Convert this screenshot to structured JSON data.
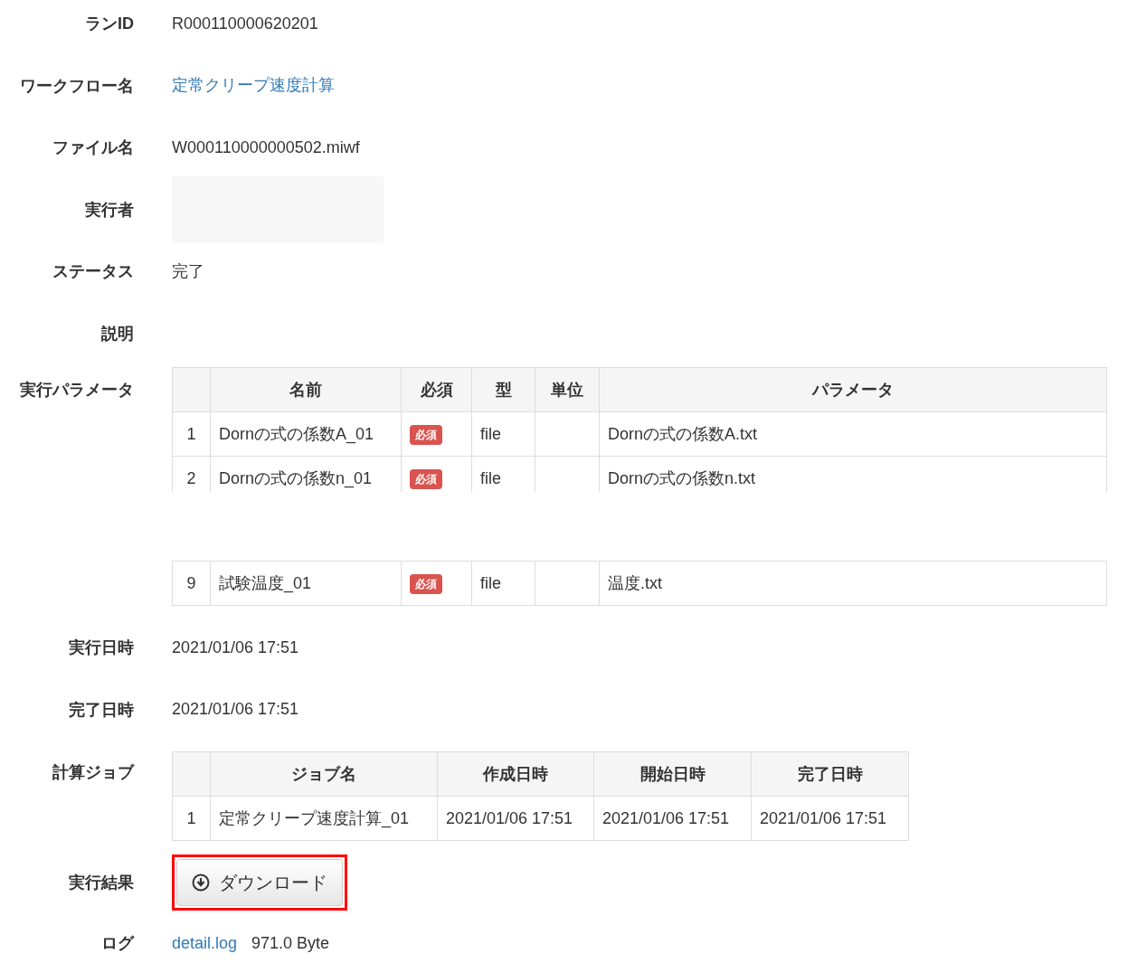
{
  "fields": [
    {
      "kind": "text",
      "label": "ランID",
      "value": "R000110000620201"
    },
    {
      "kind": "link",
      "label": "ワークフロー名",
      "value": "定常クリープ速度計算"
    },
    {
      "kind": "text",
      "label": "ファイル名",
      "value": "W000110000000502.miwf"
    },
    {
      "kind": "redacted",
      "label": "実行者"
    },
    {
      "kind": "text",
      "label": "ステータス",
      "value": "完了"
    },
    {
      "kind": "text",
      "label": "説明"
    },
    {
      "kind": "params",
      "label": "実行パラメータ",
      "columns": [
        "",
        "名前",
        "必須",
        "型",
        "単位",
        "パラメータ"
      ],
      "parts": [
        {
          "cut": true,
          "rows": [
            {
              "cells": [
                "1",
                "Dornの式の係数A_01",
                "必須",
                "file",
                "",
                "Dornの式の係数A.txt"
              ],
              "required": true
            },
            {
              "cells": [
                "2",
                "Dornの式の係数n_01",
                "必須",
                "file",
                "",
                "Dornの式の係数n.txt"
              ],
              "required": true
            }
          ]
        },
        {
          "cut": false,
          "rows": [
            {
              "cells": [
                "9",
                "試験温度_01",
                "必須",
                "file",
                "",
                "温度.txt"
              ],
              "required": true
            }
          ]
        }
      ]
    },
    {
      "kind": "text",
      "label": "実行日時",
      "value": "2021/01/06 17:51"
    },
    {
      "kind": "text",
      "label": "完了日時",
      "value": "2021/01/06 17:51"
    },
    {
      "kind": "jobs",
      "label": "計算ジョブ",
      "columns": [
        "",
        "ジョブ名",
        "作成日時",
        "開始日時",
        "完了日時"
      ],
      "rows": [
        [
          "1",
          "定常クリープ速度計算_01",
          "2021/01/06 17:51",
          "2021/01/06 17:51",
          "2021/01/06 17:51"
        ]
      ]
    },
    {
      "kind": "button",
      "label": "実行結果",
      "value": "ダウンロード",
      "highlighted": true
    },
    {
      "kind": "log",
      "label": "ログ",
      "value": "detail.log",
      "size": "971.0 Byte"
    }
  ]
}
